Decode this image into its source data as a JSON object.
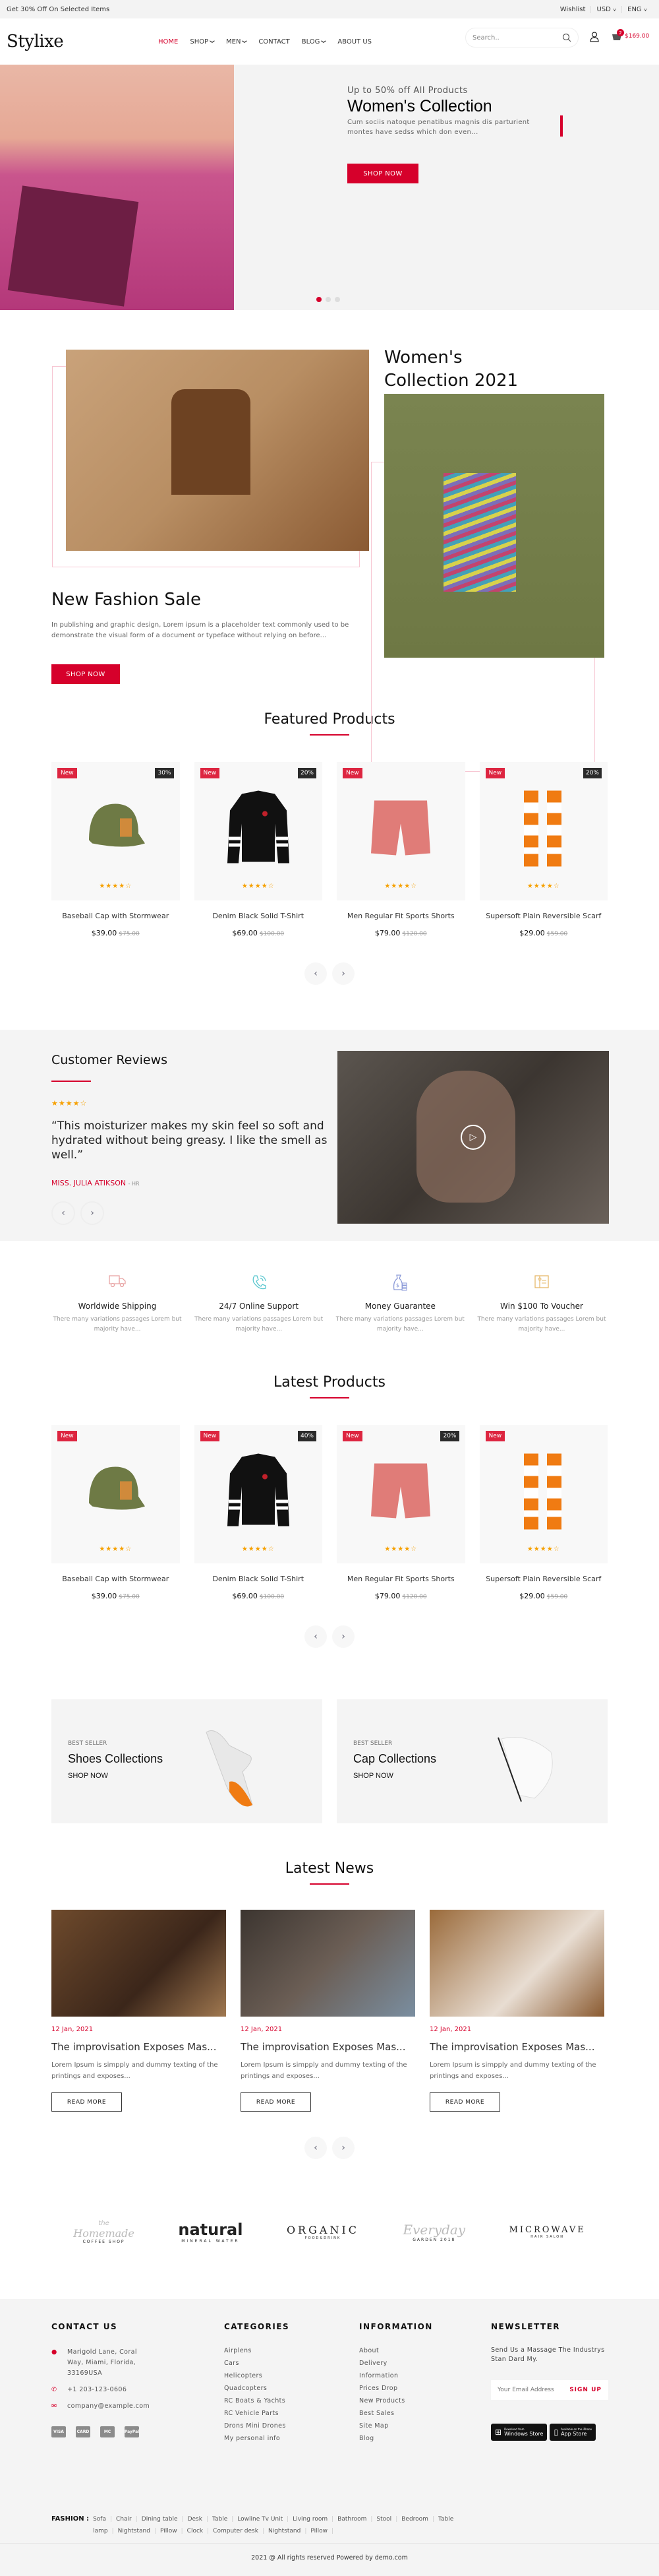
{
  "topbar": {
    "promo": "Get 30% Off On Selected Items",
    "wishlist": "Wishlist",
    "currency": "USD",
    "language": "ENG"
  },
  "header": {
    "logo": "Stylixe",
    "nav": [
      {
        "label": "HOME",
        "active": true,
        "dropdown": false
      },
      {
        "label": "SHOP",
        "active": false,
        "dropdown": true
      },
      {
        "label": "MEN",
        "active": false,
        "dropdown": true
      },
      {
        "label": "CONTACT",
        "active": false,
        "dropdown": false
      },
      {
        "label": "BLOG",
        "active": false,
        "dropdown": true
      },
      {
        "label": "ABOUT US",
        "active": false,
        "dropdown": false
      }
    ],
    "search_placeholder": "Search..",
    "cart_count": "2",
    "cart_total": "$169.00"
  },
  "hero": {
    "subtitle": "Up to 50% off All Products",
    "title": "Women's Collection",
    "description": "Cum sociis natoque penatibus magnis dis parturient montes have sedss which don even...",
    "button": "SHOP NOW",
    "slides": 3,
    "active_slide": 1
  },
  "promo": {
    "left_title": "New Fashion Sale",
    "left_desc": "In publishing and graphic design, Lorem ipsum is a placeholder text commonly used to be demonstrate the visual form of a document or typeface without relying on before...",
    "left_button": "SHOP NOW",
    "right_title_line1": "Women's",
    "right_title_line2": "Collection 2021"
  },
  "featured": {
    "title": "Featured Products",
    "products": [
      {
        "name": "Baseball Cap with Stormwear",
        "price": "$39.00",
        "old_price": "$75.00",
        "badge": "New",
        "discount": "30%",
        "rating": 4,
        "kind": "cap"
      },
      {
        "name": "Denim Black Solid T-Shirt",
        "price": "$69.00",
        "old_price": "$100.00",
        "badge": "New",
        "discount": "20%",
        "rating": 4,
        "kind": "hoodie"
      },
      {
        "name": "Men Regular Fit Sports Shorts",
        "price": "$79.00",
        "old_price": "$120.00",
        "badge": "New",
        "discount": "",
        "rating": 4,
        "kind": "shorts"
      },
      {
        "name": "Supersoft Plain Reversible Scarf",
        "price": "$29.00",
        "old_price": "$59.00",
        "badge": "New",
        "discount": "20%",
        "rating": 4,
        "kind": "scarf"
      }
    ]
  },
  "reviews": {
    "title": "Customer Reviews",
    "rating": 4,
    "quote": "“This moisturizer makes my skin feel so soft and hydrated without being greasy. I like the smell as well.”",
    "author": "MISS. JULIA ATIKSON",
    "role": "- HR"
  },
  "features": [
    {
      "icon": "truck-icon",
      "title": "Worldwide Shipping",
      "desc": "There many variations passages Lorem but majority have...",
      "color": "#e8a3a3"
    },
    {
      "icon": "phone-icon",
      "title": "24/7 Online Support",
      "desc": "There many variations passages Lorem but majority have...",
      "color": "#5cc8d0"
    },
    {
      "icon": "money-bag-icon",
      "title": "Money Guarantee",
      "desc": "There many variations passages Lorem but majority have...",
      "color": "#8b9ad8"
    },
    {
      "icon": "voucher-icon",
      "title": "Win $100 To Voucher",
      "desc": "There many variations passages Lorem but majority have...",
      "color": "#e6b86a"
    }
  ],
  "latest": {
    "title": "Latest Products",
    "products": [
      {
        "name": "Baseball Cap with Stormwear",
        "price": "$39.00",
        "old_price": "$75.00",
        "badge": "New",
        "discount": "",
        "rating": 4,
        "kind": "cap"
      },
      {
        "name": "Denim Black Solid T-Shirt",
        "price": "$69.00",
        "old_price": "$100.00",
        "badge": "New",
        "discount": "40%",
        "rating": 4,
        "kind": "hoodie"
      },
      {
        "name": "Men Regular Fit Sports Shorts",
        "price": "$79.00",
        "old_price": "$120.00",
        "badge": "New",
        "discount": "20%",
        "rating": 4,
        "kind": "shorts"
      },
      {
        "name": "Supersoft Plain Reversible Scarf",
        "price": "$29.00",
        "old_price": "$59.00",
        "badge": "New",
        "discount": "",
        "rating": 4,
        "kind": "scarf"
      }
    ]
  },
  "banners": [
    {
      "label": "BEST SELLER",
      "title": "Shoes Collections",
      "link": "SHOP NOW",
      "kind": "shoe"
    },
    {
      "label": "BEST SELLER",
      "title": "Cap Collections",
      "link": "SHOP NOW",
      "kind": "cap"
    }
  ],
  "news": {
    "title": "Latest News",
    "posts": [
      {
        "date": "12 Jan, 2021",
        "title": "The improvisation Exposes Mas...",
        "desc": "Lorem Ipsum is simpply and dummy texting of the printings and exposes...",
        "button": "READ MORE"
      },
      {
        "date": "12 Jan, 2021",
        "title": "The improvisation Exposes Mas...",
        "desc": "Lorem Ipsum is simpply and dummy texting of the printings and exposes...",
        "button": "READ MORE"
      },
      {
        "date": "12 Jan, 2021",
        "title": "The improvisation Exposes Mas...",
        "desc": "Lorem Ipsum is simpply and dummy texting of the printings and exposes...",
        "button": "READ MORE"
      }
    ]
  },
  "brands": [
    {
      "top": "the",
      "main": "Homemade",
      "sub": "COFFEE SHOP"
    },
    {
      "top": "",
      "main": "natural",
      "sub": "MINERAL WATER"
    },
    {
      "top": "",
      "main": "ORGANIC",
      "sub": "FOOD&DRINK"
    },
    {
      "top": "",
      "main": "Everyday",
      "sub": "GARDEN 2018"
    },
    {
      "top": "",
      "main": "MICROWAVE",
      "sub": "HAIR SALON"
    }
  ],
  "footer": {
    "contact_title": "CONTACT US",
    "address": "Marigold Lane, Coral Way, Miami, Florida, 33169USA",
    "phone": "+1 203-123-0606",
    "email": "company@example.com",
    "payments": [
      "VISA",
      "CARD",
      "MC",
      "PayPal"
    ],
    "categories_title": "CATEGORIES",
    "categories": [
      "Airplens",
      "Cars",
      "Helicopters",
      "Quadcopters",
      "RC Boats & Yachts",
      "RC Vehicle Parts",
      "Drons Mini Drones",
      "My personal info"
    ],
    "information_title": "INFORMATION",
    "information": [
      "About",
      "Delivery",
      "Information",
      "Prices Drop",
      "New Products",
      "Best Sales",
      "Site Map",
      "Blog"
    ],
    "newsletter_title": "NEWSLETTER",
    "newsletter_desc": "Send Us a Massage The Industrys Stan Dard My.",
    "email_placeholder": "Your Email Address",
    "signup": "SIGN UP",
    "stores": [
      {
        "small": "Download from",
        "big": "Windows Store"
      },
      {
        "small": "Available on the iPhone",
        "big": "App Store"
      }
    ],
    "tags_label": "FASHION :",
    "tags": [
      "Sofa",
      "Chair",
      "Dining table",
      "Desk",
      "Table",
      "Lowline Tv Unit",
      "Living room",
      "Bathroom",
      "Stool",
      "Bedroom",
      "Table lamp",
      "Nightstand",
      "Pillow",
      "Clock",
      "Computer desk",
      "Nightstand",
      "Pillow"
    ],
    "copyright": "2021 @ All rights reserved Powered by demo.com"
  }
}
